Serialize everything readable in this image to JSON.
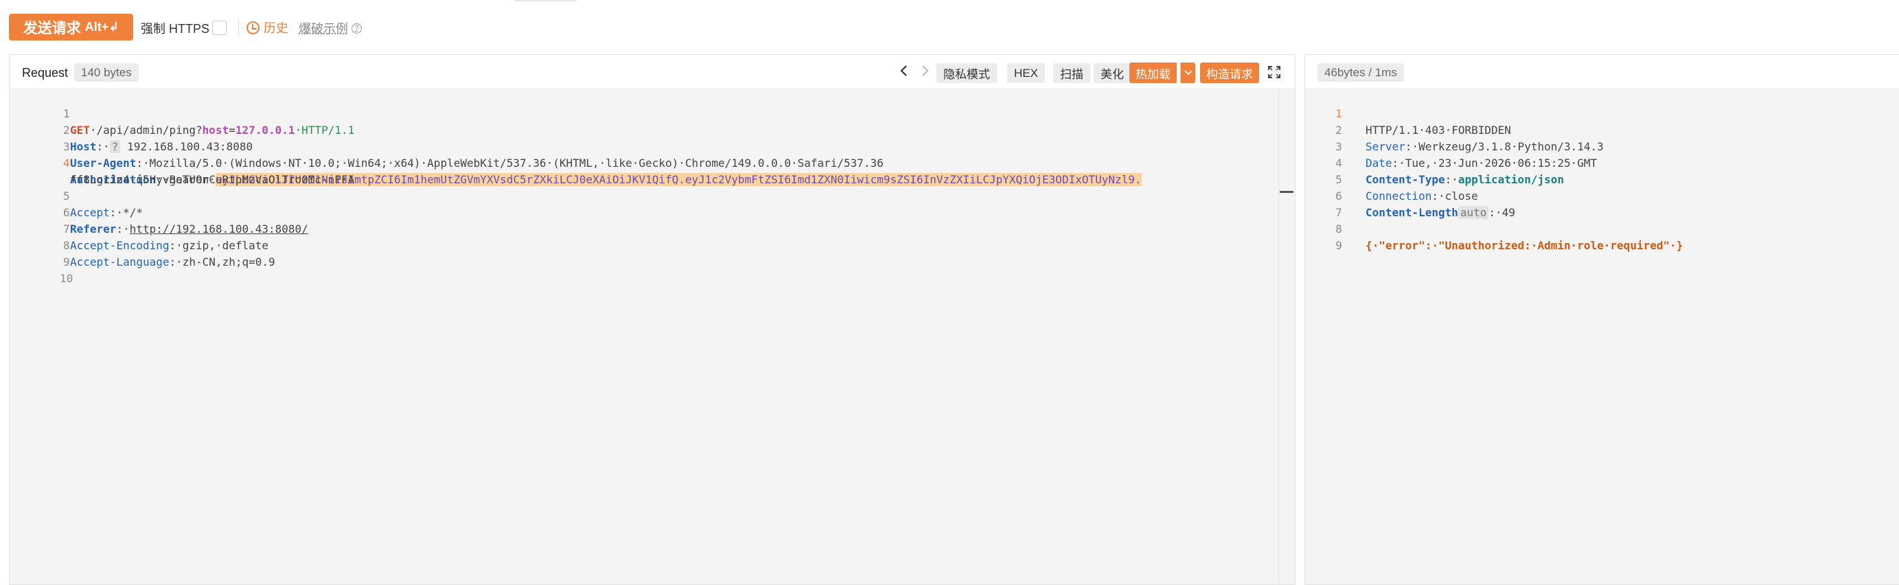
{
  "toolbar": {
    "send_label": "发送请求",
    "send_shortcut": "Alt+↲",
    "force_https_label": "强制 HTTPS",
    "history_label": "历史",
    "example_label": "爆破示例"
  },
  "request": {
    "title": "Request",
    "size": "140 bytes",
    "buttons": {
      "private_mode": "隐私模式",
      "hex": "HEX",
      "scan": "扫描",
      "beautify": "美化",
      "hot_load": "热加载",
      "build_request": "构造请求"
    },
    "lines": [
      {
        "n": "1",
        "method": "GET",
        "path": "·/api/admin/ping?",
        "param_key": "host",
        "param_eq": "=",
        "param_val": "127.0.0.1",
        "proto": "·HTTP/1.1"
      },
      {
        "n": "2",
        "name": "Host",
        "sep": ":·",
        "chip": "?",
        "val": " 192.168.100.43:8080"
      },
      {
        "n": "3",
        "name": "User-Agent",
        "sep": ":·",
        "val": "Mozilla/5.0·(Windows·NT·10.0;·Win64;·x64)·AppleWebKit/537.36·(KHTML,·like·Gecko)·Chrome/149.0.0.0·Safari/537.36"
      },
      {
        "n": "4",
        "name": "Authorization",
        "sep": ":·",
        "val": "Bearer·",
        "hi": "eyJhbGciOiJIUzI1NiIsImtpZCI6Im1hemUtZGVmYXVsdC5rZXkiLCJ0eXAiOiJKV1QifQ.eyJ1c2VybmFtZSI6Imd1ZXN0Iiwicm9sZSI6InVzZXIiLCJpYXQiOjE3ODIxOTUyNzl9.",
        "cont": "ff8Lg1Jn4-q5HyvgaTUOnCuRtpMzVaOlTro0Mc-nPFA"
      },
      {
        "n": "5",
        "name": "Accept",
        "sep": ":·",
        "val": "*/*"
      },
      {
        "n": "6",
        "name": "Referer",
        "sep": ":·",
        "link": "http://192.168.100.43:8080/"
      },
      {
        "n": "7",
        "name": "Accept-Encoding",
        "sep": ":·",
        "val": "gzip,·deflate"
      },
      {
        "n": "8",
        "name": "Accept-Language",
        "sep": ":·",
        "val": "zh-CN,zh;q=0.9"
      },
      {
        "n": "9"
      },
      {
        "n": "10"
      }
    ]
  },
  "response": {
    "meta": "46bytes / 1ms",
    "lines": [
      {
        "n": "1",
        "status": "HTTP/1.1·403·FORBIDDEN"
      },
      {
        "n": "2",
        "name": "Server",
        "sep": ":·",
        "val": "Werkzeug/3.1.8·Python/3.14.3"
      },
      {
        "n": "3",
        "name": "Date",
        "sep": ":·",
        "val": "Tue,·23·Jun·2026·06:15:25·GMT"
      },
      {
        "n": "4",
        "name": "Content-Type",
        "sep": ":·",
        "ct": "application/json"
      },
      {
        "n": "5",
        "name": "Connection",
        "sep": ":·",
        "val": "close"
      },
      {
        "n": "6",
        "name": "Content-Length",
        "chip": "auto",
        "sep": ":·",
        "val": "49"
      },
      {
        "n": "7"
      },
      {
        "n": "8",
        "json": "{·\"error\":·\"Unauthorized:·Admin·role·required\"·}"
      },
      {
        "n": "9"
      }
    ]
  }
}
